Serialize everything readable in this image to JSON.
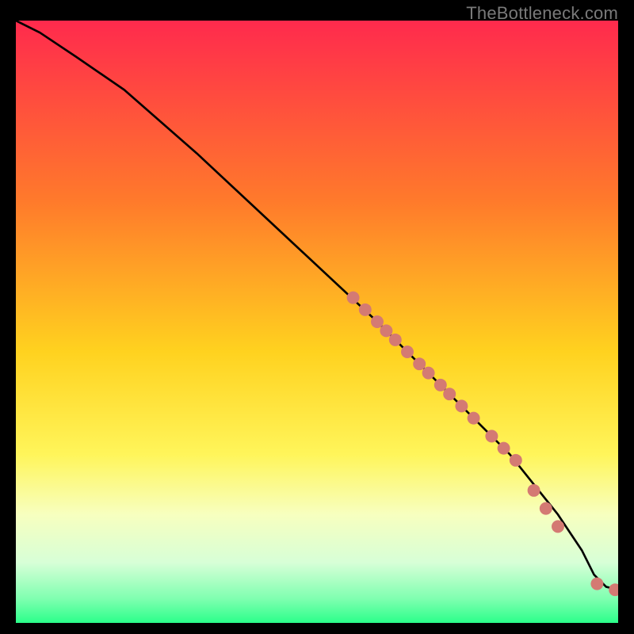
{
  "attribution": "TheBottleneck.com",
  "chart_data": {
    "type": "line",
    "title": "",
    "xlabel": "",
    "ylabel": "",
    "xlim": [
      0,
      100
    ],
    "ylim": [
      0,
      100
    ],
    "gradient_stops": [
      {
        "offset": 0,
        "color": "#ff2a4d"
      },
      {
        "offset": 0.3,
        "color": "#ff7a2b"
      },
      {
        "offset": 0.55,
        "color": "#ffd21f"
      },
      {
        "offset": 0.72,
        "color": "#fff55a"
      },
      {
        "offset": 0.82,
        "color": "#f7ffbf"
      },
      {
        "offset": 0.9,
        "color": "#d7ffd7"
      },
      {
        "offset": 0.96,
        "color": "#7fffb0"
      },
      {
        "offset": 1.0,
        "color": "#2bff8a"
      }
    ],
    "series": [
      {
        "name": "bottleneck-curve",
        "x": [
          0,
          4,
          10,
          18,
          30,
          45,
          60,
          72,
          82,
          90,
          94,
          96,
          98,
          100
        ],
        "y": [
          100,
          98,
          94,
          88.5,
          78,
          64,
          50,
          38,
          28,
          18,
          12,
          8,
          6,
          5.5
        ]
      }
    ],
    "points": {
      "name": "sample-points",
      "color": "#d47a73",
      "radius": 8,
      "x": [
        56,
        58,
        60,
        61.5,
        63,
        65,
        67,
        68.5,
        70.5,
        72,
        74,
        76,
        79,
        81,
        83,
        86,
        88,
        90,
        96.5,
        99.5
      ],
      "y": [
        54,
        52,
        50,
        48.5,
        47,
        45,
        43,
        41.5,
        39.5,
        38,
        36,
        34,
        31,
        29,
        27,
        22,
        19,
        16,
        6.5,
        5.5
      ]
    }
  }
}
